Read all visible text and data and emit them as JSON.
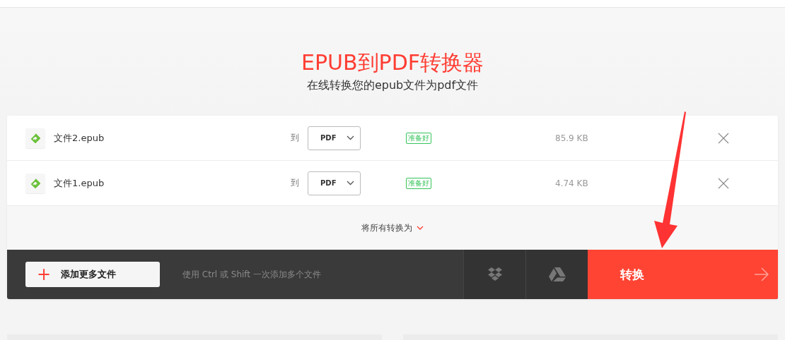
{
  "title": "EPUB到PDF转换器",
  "subtitle": "在线转换您的epub文件为pdf文件",
  "files": [
    {
      "name": "文件2.epub",
      "to_label": "到",
      "format": "PDF",
      "status": "准备好",
      "size": "85.9 KB"
    },
    {
      "name": "文件1.epub",
      "to_label": "到",
      "format": "PDF",
      "status": "准备好",
      "size": "4.74 KB"
    }
  ],
  "convert_all_label": "将所有转换为",
  "toolbar": {
    "add_button": "添加更多文件",
    "plus": "+",
    "hint": "使用 Ctrl 或 Shift 一次添加多个文件",
    "convert_button": "转换"
  }
}
